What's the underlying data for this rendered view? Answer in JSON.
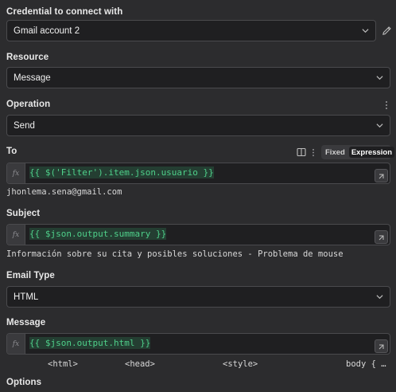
{
  "credential": {
    "label": "Credential to connect with",
    "value": "Gmail account 2"
  },
  "resource": {
    "label": "Resource",
    "value": "Message"
  },
  "operation": {
    "label": "Operation",
    "value": "Send"
  },
  "to": {
    "label": "To",
    "toggle_fixed": "Fixed",
    "toggle_expression": "Expression",
    "fx": "fx",
    "expression": "{{ $('Filter').item.json.usuario }}",
    "result": "jhonlema.sena@gmail.com"
  },
  "subject": {
    "label": "Subject",
    "fx": "fx",
    "expression": "{{ $json.output.summary }}",
    "result": "Información sobre su cita y posibles soluciones - Problema de mouse"
  },
  "email_type": {
    "label": "Email Type",
    "value": "HTML"
  },
  "message": {
    "label": "Message",
    "fx": "fx",
    "expression": "{{ $json.output.html }}",
    "preview_html": "<html>",
    "preview_head": "<head>",
    "preview_style": "<style>",
    "preview_body": "body { …"
  },
  "options": {
    "label": "Options"
  },
  "colors": {
    "background": "#2c2c2e",
    "input_bg": "#1f1f21",
    "expression_green": "#4fd08a"
  },
  "icons": [
    "chevron-down-icon",
    "pencil-icon",
    "kebab-menu-icon",
    "panel-icon",
    "expand-icon"
  ]
}
